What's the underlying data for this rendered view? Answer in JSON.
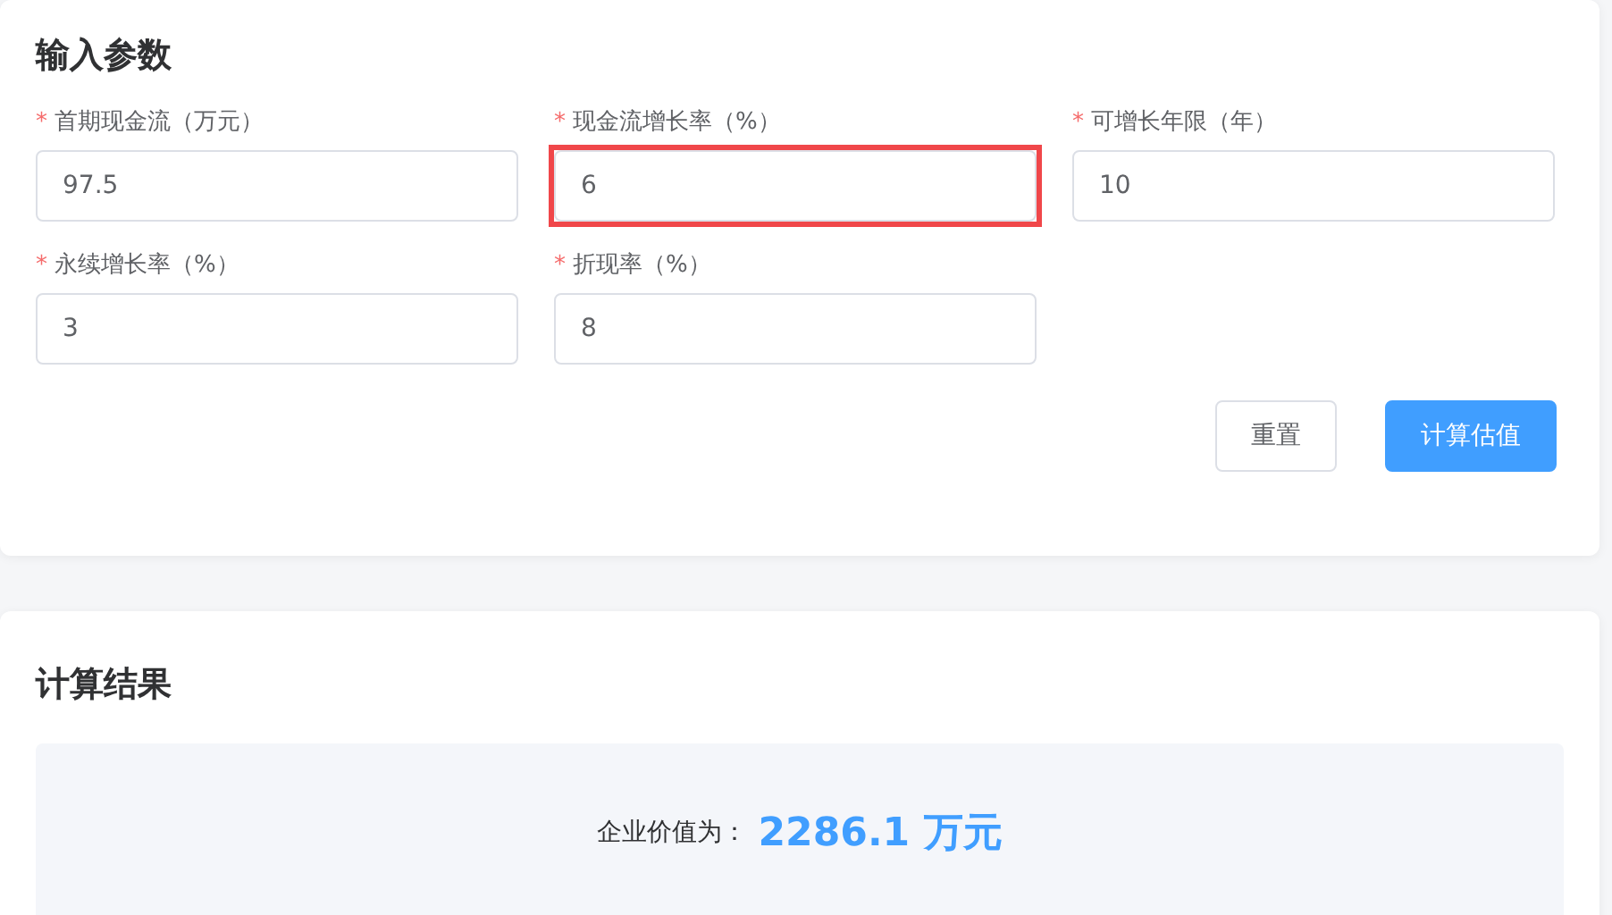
{
  "input_card": {
    "title": "输入参数",
    "fields": [
      {
        "mark": "*",
        "label": "首期现金流（万元）",
        "value": "97.5",
        "highlighted": false
      },
      {
        "mark": "*",
        "label": "现金流增长率（%）",
        "value": "6",
        "highlighted": true
      },
      {
        "mark": "*",
        "label": "可增长年限（年）",
        "value": "10",
        "highlighted": false
      },
      {
        "mark": "*",
        "label": "永续增长率（%）",
        "value": "3",
        "highlighted": false
      },
      {
        "mark": "*",
        "label": "折现率（%）",
        "value": "8",
        "highlighted": false
      }
    ],
    "buttons": [
      {
        "label": "重置",
        "kind": "default"
      },
      {
        "label": "计算估值",
        "kind": "primary"
      }
    ]
  },
  "result_card": {
    "title": "计算结果",
    "label": "企业价值为：",
    "value": "2286.1 万元"
  }
}
